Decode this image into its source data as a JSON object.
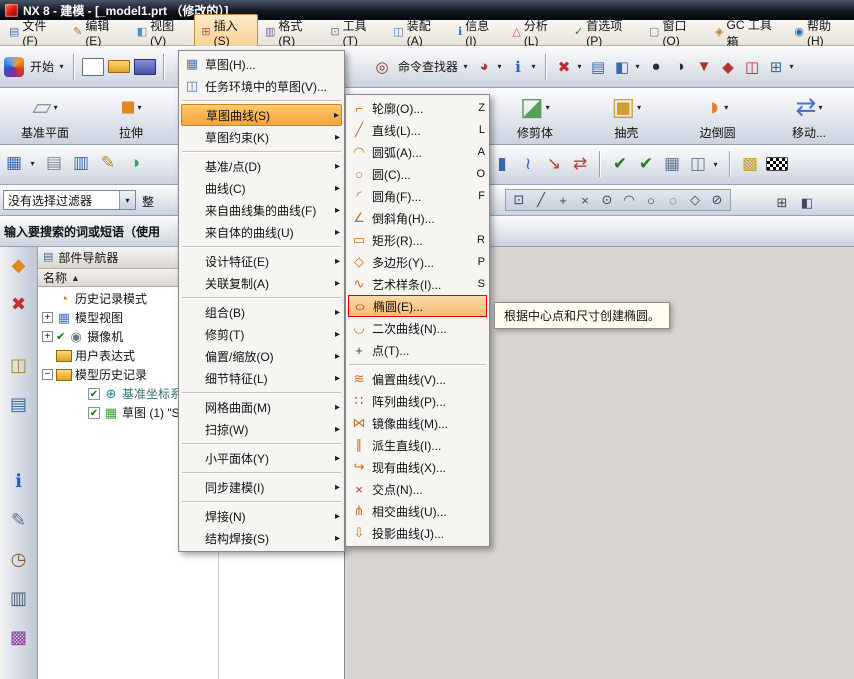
{
  "window": {
    "title": "NX 8 - 建模 - [_model1.prt （修改的）]"
  },
  "menubar": [
    {
      "dn": "menu-file",
      "gn": "file-menu-icon",
      "g": "▤",
      "gc": "#4878b8",
      "t": "文件(F)"
    },
    {
      "dn": "menu-edit",
      "gn": "edit-menu-icon",
      "g": "✎",
      "gc": "#b07030",
      "t": "编辑(E)"
    },
    {
      "dn": "menu-view",
      "gn": "view-menu-icon",
      "g": "◧",
      "gc": "#4890c8",
      "t": "视图(V)"
    },
    {
      "dn": "menu-insert",
      "gn": "insert-menu-icon",
      "g": "⊞",
      "gc": "#c05858",
      "t": "插入(S)",
      "cls": "active"
    },
    {
      "dn": "menu-format",
      "gn": "format-menu-icon",
      "g": "▥",
      "gc": "#8860a8",
      "t": "格式(R)"
    },
    {
      "dn": "menu-tools",
      "gn": "tools-menu-icon",
      "g": "⊡",
      "gc": "#607890",
      "t": "工具(T)"
    },
    {
      "dn": "menu-assemblies",
      "gn": "assemblies-menu-icon",
      "g": "◫",
      "gc": "#4878b8",
      "t": "装配(A)"
    },
    {
      "dn": "menu-information",
      "gn": "information-menu-icon",
      "g": "ℹ",
      "gc": "#2868c0",
      "t": "信息(I)"
    },
    {
      "dn": "menu-analysis",
      "gn": "analysis-menu-icon",
      "g": "△",
      "gc": "#c05050",
      "t": "分析(L)"
    },
    {
      "dn": "menu-preferences",
      "gn": "preferences-menu-icon",
      "g": "✓",
      "gc": "#308030",
      "t": "首选项(P)"
    },
    {
      "dn": "menu-window",
      "gn": "window-menu-icon",
      "g": "▢",
      "gc": "#607890",
      "t": "窗口(O)"
    },
    {
      "dn": "menu-gc-toolbox",
      "gn": "gc-toolbox-menu-icon",
      "g": "◈",
      "gc": "#c08020",
      "t": "GC 工具箱"
    },
    {
      "dn": "menu-help",
      "gn": "help-menu-icon",
      "g": "◉",
      "gc": "#2868c0",
      "t": "帮助(H)"
    }
  ],
  "toolbar_main": [
    {
      "n": "start-icon",
      "cls": "start-swirl",
      "it": "true"
    },
    {
      "n": "start-label",
      "t": "开始",
      "cls": "tlabel",
      "it": "true"
    },
    {
      "n": "start-caret",
      "t": "▾",
      "cls": "caret",
      "it": "true"
    },
    {
      "n": "toolbar-separator",
      "cls": "tsep",
      "it": "false"
    },
    {
      "n": "new-file-button",
      "cls": "icon-page",
      "it": "true"
    },
    {
      "n": "open-file-button",
      "cls": "icon-folder",
      "it": "true"
    },
    {
      "n": "save-button",
      "cls": "icon-floppy",
      "it": "true"
    },
    {
      "n": "toolbar-separator",
      "cls": "tsep",
      "it": "false"
    },
    {
      "n": "toolbar-gap",
      "cls": "tgap",
      "it": "false"
    },
    {
      "n": "command-finder-icon",
      "t": "◎",
      "c": "#8c2f2f",
      "cls": "tico",
      "it": "true"
    },
    {
      "n": "command-finder-label",
      "t": "命令查找器",
      "cls": "tlabel",
      "it": "true"
    },
    {
      "n": "command-finder-caret",
      "t": "▾",
      "cls": "caret",
      "it": "true"
    },
    {
      "n": "selection-ball-icon",
      "t": "◕",
      "c": "#b04030",
      "cls": "tico",
      "it": "true"
    },
    {
      "n": "selection-ball-caret",
      "t": "▾",
      "cls": "caret",
      "it": "true"
    },
    {
      "n": "information-icon",
      "t": "ℹ",
      "c": "#2868c0",
      "cls": "tico",
      "it": "true"
    },
    {
      "n": "information-caret",
      "t": "▾",
      "cls": "caret",
      "it": "true"
    },
    {
      "n": "toolbar-separator",
      "cls": "tsep",
      "it": "false"
    },
    {
      "n": "reset-filter-icon",
      "t": "✖",
      "c": "#c03030",
      "cls": "tico",
      "it": "true"
    },
    {
      "n": "reset-filter-caret",
      "t": "▾",
      "cls": "caret",
      "it": "true"
    },
    {
      "n": "layer-settings-icon",
      "t": "▤",
      "c": "#3868b0",
      "cls": "tico",
      "it": "true"
    },
    {
      "n": "view-cube-icon",
      "t": "◧",
      "c": "#3868b0",
      "cls": "tico",
      "it": "true"
    },
    {
      "n": "view-cube-caret",
      "t": "▾",
      "cls": "caret",
      "it": "true"
    },
    {
      "n": "shaded-display-icon",
      "t": "●",
      "c": "#2a3038",
      "cls": "tico",
      "it": "true"
    },
    {
      "n": "render-style-icon",
      "t": "◑",
      "c": "#2a3038",
      "cls": "tico",
      "it": "true"
    },
    {
      "n": "material-goblet-icon",
      "t": "▼",
      "c": "#b03030",
      "cls": "tico",
      "it": "true"
    },
    {
      "n": "material-cube-icon",
      "t": "◆",
      "c": "#b03030",
      "cls": "tico",
      "it": "true"
    },
    {
      "n": "assembly-constraints-icon",
      "t": "◫",
      "c": "#b03030",
      "cls": "tico",
      "it": "true"
    },
    {
      "n": "modeling-tools-icon",
      "t": "⊞",
      "c": "#3868b0",
      "cls": "tico",
      "it": "true"
    },
    {
      "n": "modeling-tools-caret",
      "t": "▾",
      "cls": "caret",
      "it": "true"
    }
  ],
  "feature_bar_left": [
    {
      "n": "datum-plane-button",
      "gn": "datum-plane-icon",
      "g": "▱",
      "c": "#8898a8",
      "caret": "▾",
      "label": "基准平面"
    },
    {
      "n": "extrude-button",
      "gn": "extrude-icon",
      "g": "■",
      "c": "#e08828",
      "caret": "▾",
      "label": "拉伸"
    }
  ],
  "feature_bar_right": [
    {
      "n": "trim-body-button",
      "gn": "trim-body-icon",
      "g": "◪",
      "c": "#58a058",
      "caret": "▾",
      "label": "修剪体"
    },
    {
      "n": "shell-button",
      "gn": "shell-icon",
      "g": "▣",
      "c": "#d0a030",
      "caret": "▾",
      "label": "抽壳"
    },
    {
      "n": "edge-blend-button",
      "gn": "edge-blend-icon",
      "g": "◗",
      "c": "#e08030",
      "caret": "▾",
      "label": "边倒圆"
    },
    {
      "n": "move-object-button",
      "gn": "move-object-icon",
      "g": "⇄",
      "c": "#4878c0",
      "caret": "▾",
      "label": "移动..."
    }
  ],
  "toolbar_row3_left": [
    {
      "n": "direct-sketch-icon",
      "t": "▦",
      "c": "#3868b0",
      "cls": "tico2",
      "it": "true"
    },
    {
      "n": "sketch-dropdown-caret",
      "t": "▾",
      "cls": "caret",
      "it": "true"
    },
    {
      "n": "layers-icon",
      "t": "▤",
      "c": "#808890",
      "cls": "tico2",
      "it": "true"
    },
    {
      "n": "books-icon",
      "t": "▥",
      "c": "#3868b0",
      "cls": "tico2",
      "it": "true"
    },
    {
      "n": "pen-icon",
      "t": "✎",
      "c": "#c08030",
      "cls": "tico2",
      "it": "true"
    },
    {
      "n": "glass-icon",
      "t": "◑",
      "c": "#30a070",
      "cls": "tico2",
      "it": "true"
    }
  ],
  "toolbar_row3_right": [
    {
      "n": "boss-icon",
      "t": "▮",
      "c": "#3868b0",
      "cls": "tico2",
      "it": "true"
    },
    {
      "n": "spring-icon",
      "t": "≀",
      "c": "#3868b0",
      "cls": "tico2",
      "it": "true"
    },
    {
      "n": "measure-icon",
      "t": "↘",
      "c": "#b04030",
      "cls": "tico2",
      "it": "true"
    },
    {
      "n": "arrows-icon",
      "t": "⇄",
      "c": "#b04030",
      "cls": "tico2",
      "it": "true"
    },
    {
      "n": "toolbar-separator",
      "cls": "tsep",
      "it": "false"
    },
    {
      "n": "examine-geometry-icon",
      "t": "✔",
      "c": "#208020",
      "cls": "tico2",
      "it": "true"
    },
    {
      "n": "check-all-icon",
      "t": "✔",
      "c": "#208020",
      "cls": "tico2",
      "it": "true"
    },
    {
      "n": "table-icon",
      "t": "▦",
      "c": "#607890",
      "cls": "tico2",
      "it": "true"
    },
    {
      "n": "window-layout-icon",
      "t": "◫",
      "c": "#607890",
      "cls": "tico2",
      "it": "true"
    },
    {
      "n": "layout-caret",
      "t": "▾",
      "cls": "caret",
      "it": "true"
    },
    {
      "n": "toolbar-separator",
      "cls": "tsep",
      "it": "false"
    },
    {
      "n": "grid-icon",
      "t": "▩",
      "c": "#c0a030",
      "cls": "tico2",
      "it": "true"
    },
    {
      "n": "checkered-flag-icon",
      "cls": "icon-checker",
      "it": "true"
    }
  ],
  "filter": {
    "value": "没有选择过滤器",
    "caret": "▾",
    "scope_partial": "整"
  },
  "snap_bar": [
    {
      "n": "snap-enable-icon",
      "t": "⊡",
      "c": "#404858",
      "cls": "snapico",
      "it": "true"
    },
    {
      "n": "snap-endpoint-icon",
      "t": "╱",
      "c": "#404858",
      "cls": "snapico",
      "it": "true"
    },
    {
      "n": "snap-midpoint-icon",
      "t": "+",
      "c": "#404858",
      "cls": "snapico",
      "it": "true"
    },
    {
      "n": "snap-intersection-icon",
      "t": "×",
      "c": "#404858",
      "cls": "snapico",
      "it": "true"
    },
    {
      "n": "snap-arc-center-icon",
      "t": "⊙",
      "c": "#404858",
      "cls": "snapico",
      "it": "true"
    },
    {
      "n": "snap-quadrant-icon",
      "t": "◠",
      "c": "#404858",
      "cls": "snapico",
      "it": "true"
    },
    {
      "n": "snap-existing-point-icon",
      "t": "○",
      "c": "#404858",
      "cls": "snapico",
      "it": "true"
    },
    {
      "n": "snap-point-on-curve-icon",
      "t": "◌",
      "c": "#404858",
      "cls": "snapico",
      "it": "true"
    },
    {
      "n": "snap-point-on-surface-icon",
      "t": "◇",
      "c": "#404858",
      "cls": "snapico",
      "it": "true"
    },
    {
      "n": "snap-tangent-icon",
      "t": "⊘",
      "c": "#404858",
      "cls": "snapico",
      "it": "true"
    }
  ],
  "snap_extra": [
    {
      "n": "snap-settings-icon",
      "t": "⊞",
      "c": "#404858",
      "cls": "snapico",
      "it": "true"
    },
    {
      "n": "snap-more-icon",
      "t": "◧",
      "c": "#404858",
      "cls": "snapico",
      "it": "true"
    }
  ],
  "search_hint": "输入要搜索的词或短语（使用",
  "insert_menu": {
    "items": [
      {
        "dn": "menu-item-sketch",
        "gn": "sketch-icon",
        "g": "▦",
        "gc": "#4878b8",
        "t": "草图(H)..."
      },
      {
        "dn": "menu-item-sketch-in-task",
        "gn": "sketch-task-icon",
        "g": "◫",
        "gc": "#4878b8",
        "t": "任务环境中的草图(V)..."
      },
      {
        "cls": "msep"
      },
      {
        "dn": "menu-item-sketch-curve",
        "t": "草图曲线(S)",
        "ar": "▸",
        "cls": "hl"
      },
      {
        "dn": "menu-item-sketch-constraint",
        "t": "草图约束(K)",
        "ar": "▸"
      },
      {
        "cls": "msep"
      },
      {
        "dn": "menu-item-datum-point",
        "t": "基准/点(D)",
        "ar": "▸"
      },
      {
        "dn": "menu-item-curve",
        "t": "曲线(C)",
        "ar": "▸"
      },
      {
        "dn": "menu-item-curve-from-curves",
        "t": "来自曲线集的曲线(F)",
        "ar": "▸"
      },
      {
        "dn": "menu-item-curve-from-bodies",
        "t": "来自体的曲线(U)",
        "ar": "▸"
      },
      {
        "cls": "msep"
      },
      {
        "dn": "menu-item-design-feature",
        "t": "设计特征(E)",
        "ar": "▸"
      },
      {
        "dn": "menu-item-associative-copy",
        "t": "关联复制(A)",
        "ar": "▸"
      },
      {
        "cls": "msep"
      },
      {
        "dn": "menu-item-combine",
        "t": "组合(B)",
        "ar": "▸"
      },
      {
        "dn": "menu-item-trim",
        "t": "修剪(T)",
        "ar": "▸"
      },
      {
        "dn": "menu-item-offset-scale",
        "t": "偏置/缩放(O)",
        "ar": "▸"
      },
      {
        "dn": "menu-item-detail-feature",
        "t": "细节特征(L)",
        "ar": "▸"
      },
      {
        "cls": "msep"
      },
      {
        "dn": "menu-item-mesh-surface",
        "t": "网格曲面(M)",
        "ar": "▸"
      },
      {
        "dn": "menu-item-sweep",
        "t": "扫掠(W)",
        "ar": "▸"
      },
      {
        "cls": "msep"
      },
      {
        "dn": "menu-item-facet-body",
        "t": "小平面体(Y)",
        "ar": "▸"
      },
      {
        "cls": "msep"
      },
      {
        "dn": "menu-item-synchronous-modeling",
        "t": "同步建模(I)",
        "ar": "▸"
      },
      {
        "cls": "msep"
      },
      {
        "dn": "menu-item-weld",
        "t": "焊接(N)",
        "ar": "▸"
      },
      {
        "dn": "menu-item-structure-weld",
        "t": "结构焊接(S)",
        "ar": "▸"
      }
    ]
  },
  "sketch_submenu": {
    "items": [
      {
        "dn": "submenu-item-profile",
        "gn": "profile-icon",
        "g": "⌐",
        "gc": "#c87020",
        "t": "轮廓(O)...",
        "k": "Z"
      },
      {
        "dn": "submenu-item-line",
        "gn": "line-icon",
        "g": "╱",
        "gc": "#c87020",
        "t": "直线(L)...",
        "k": "L"
      },
      {
        "dn": "submenu-item-arc",
        "gn": "arc-icon",
        "g": "◠",
        "gc": "#c87020",
        "t": "圆弧(A)...",
        "k": "A"
      },
      {
        "dn": "submenu-item-circle",
        "gn": "circle-icon",
        "g": "○",
        "gc": "#c87020",
        "t": "圆(C)...",
        "k": "O"
      },
      {
        "dn": "submenu-item-fillet",
        "gn": "fillet-icon",
        "g": "◜",
        "gc": "#c87020",
        "t": "圆角(F)...",
        "k": "F"
      },
      {
        "dn": "submenu-item-chamfer",
        "gn": "chamfer-icon",
        "g": "∠",
        "gc": "#c87020",
        "t": "倒斜角(H)..."
      },
      {
        "dn": "submenu-item-rectangle",
        "gn": "rectangle-icon",
        "g": "▭",
        "gc": "#c87020",
        "t": "矩形(R)...",
        "k": "R"
      },
      {
        "dn": "submenu-item-polygon",
        "gn": "polygon-icon",
        "g": "◇",
        "gc": "#c87020",
        "t": "多边形(Y)...",
        "k": "P"
      },
      {
        "dn": "submenu-item-studio-spline",
        "gn": "studio-spline-icon",
        "g": "∿",
        "gc": "#c87020",
        "t": "艺术样条(I)...",
        "k": "S"
      },
      {
        "dn": "submenu-item-ellipse",
        "gn": "ellipse-icon",
        "g": "○",
        "gc": "#c03030",
        "gcls": "wide",
        "t": "椭圆(E)...",
        "cls": "sel"
      },
      {
        "dn": "submenu-item-conic",
        "gn": "conic-icon",
        "g": "◡",
        "gc": "#c87020",
        "t": "二次曲线(N)..."
      },
      {
        "dn": "submenu-item-point",
        "gn": "point-icon",
        "g": "+",
        "gc": "#404040",
        "t": "点(T)..."
      },
      {
        "cls": "msep"
      },
      {
        "dn": "submenu-item-offset-curve",
        "gn": "offset-curve-icon",
        "g": "≋",
        "gc": "#c87020",
        "t": "偏置曲线(V)..."
      },
      {
        "dn": "submenu-item-pattern-curve",
        "gn": "pattern-curve-icon",
        "g": "∷",
        "gc": "#c03030",
        "t": "阵列曲线(P)..."
      },
      {
        "dn": "submenu-item-mirror-curve",
        "gn": "mirror-curve-icon",
        "g": "⋈",
        "gc": "#c87020",
        "t": "镜像曲线(M)..."
      },
      {
        "dn": "submenu-item-derived-line",
        "gn": "derived-line-icon",
        "g": "∥",
        "gc": "#c87020",
        "t": "派生直线(I)..."
      },
      {
        "dn": "submenu-item-existing-curve",
        "gn": "existing-curve-icon",
        "g": "↪",
        "gc": "#c87020",
        "t": "现有曲线(X)..."
      },
      {
        "dn": "submenu-item-intersection-point",
        "gn": "intersection-point-icon",
        "g": "×",
        "gc": "#c03030",
        "t": "交点(N)..."
      },
      {
        "dn": "submenu-item-intersection-curve",
        "gn": "intersection-curve-icon",
        "g": "⋔",
        "gc": "#c87020",
        "t": "相交曲线(U)..."
      },
      {
        "dn": "submenu-item-project-curve",
        "gn": "project-curve-icon",
        "g": "⇩",
        "gc": "#c87020",
        "t": "投影曲线(J)..."
      }
    ]
  },
  "tooltip": {
    "text": "根据中心点和尺寸创建椭圆。"
  },
  "part_navigator": {
    "title": "部件导航器",
    "icon": "▤",
    "name_column": "名称",
    "sort_indicator": "▲",
    "rows": [
      {
        "dn": "tree-item-history-mode",
        "gn": "history-mode-icon",
        "g": "◔",
        "gc": "#c87820",
        "t": "历史记录模式"
      },
      {
        "dn": "tree-item-model-views",
        "exp": "+",
        "gn": "model-views-icon",
        "g": "▦",
        "gc": "#4878c0",
        "t": "模型视图"
      },
      {
        "dn": "tree-item-cameras",
        "exp": "+",
        "chk": "✔",
        "gn": "camera-icon",
        "g": "◉",
        "gc": "#687888",
        "t": "摄像机"
      },
      {
        "dn": "tree-item-user-expressions",
        "gn": "folder-icon",
        "gcls": "foldr",
        "t": "用户表达式"
      },
      {
        "dn": "tree-item-model-history",
        "exp": "−",
        "gn": "folder-icon",
        "gcls": "foldr",
        "t": "模型历史记录"
      },
      {
        "dn": "tree-item-datum-csys",
        "cls": "indent1 boxed dim",
        "chk": "✔",
        "gn": "datum-csys-icon",
        "g": "⊕",
        "gc": "#208898",
        "t": "基准坐标系"
      },
      {
        "dn": "tree-item-sketch-1",
        "cls": "indent1 boxed",
        "chk": "✔",
        "gn": "sketch-icon",
        "g": "▦",
        "gc": "#40a040",
        "t": "草图 (1) \"S..."
      }
    ]
  },
  "resource_bar": [
    {
      "n": "roles-icon",
      "t": "◆",
      "c": "#e08820",
      "cls": "rico",
      "it": "true"
    },
    {
      "n": "constraint-navigator-icon",
      "t": "✖",
      "c": "#c03030",
      "cls": "rico",
      "it": "true"
    },
    {
      "n": "assembly-navigator-icon",
      "t": "◫",
      "c": "#b08838",
      "cls": "rico rgap",
      "it": "true"
    },
    {
      "n": "part-navigator-icon",
      "t": "▤",
      "c": "#3868a8",
      "cls": "rico",
      "it": "true"
    },
    {
      "n": "hd3d-tools-icon",
      "t": "ℹ",
      "c": "#2060c0",
      "cls": "rico rgap2",
      "it": "true"
    },
    {
      "n": "notes-icon",
      "t": "✎",
      "c": "#607080",
      "cls": "rico",
      "it": "true"
    },
    {
      "n": "history-palette-icon",
      "t": "◷",
      "c": "#806030",
      "cls": "rico",
      "it": "true"
    },
    {
      "n": "process-studio-icon",
      "t": "▥",
      "c": "#486078",
      "cls": "rico",
      "it": "true"
    },
    {
      "n": "system-materials-icon",
      "t": "▩",
      "c": "#9040a0",
      "cls": "rico",
      "it": "true"
    }
  ]
}
